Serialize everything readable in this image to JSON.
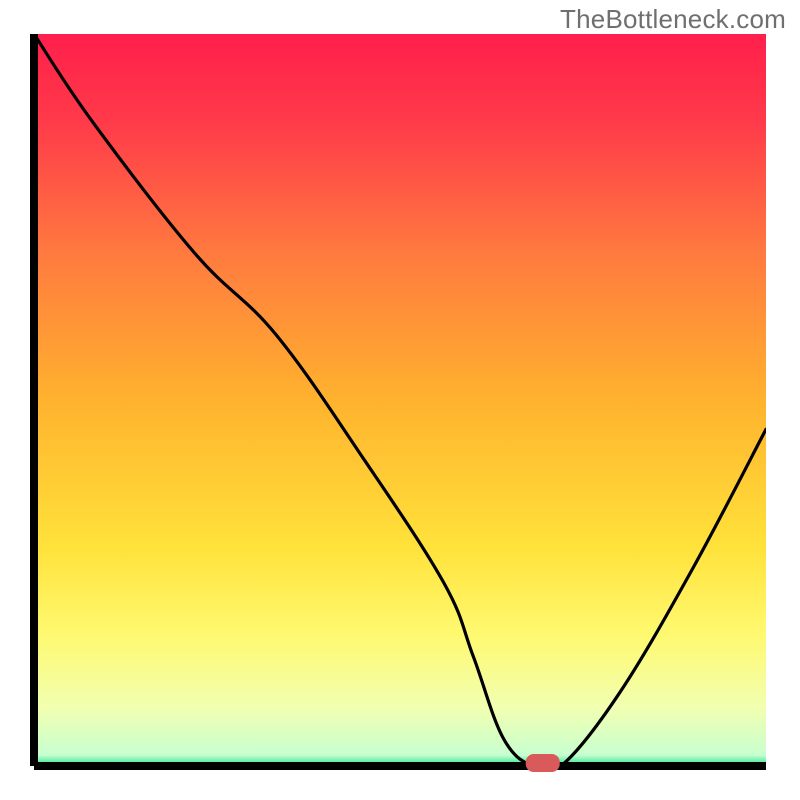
{
  "watermark": {
    "text": "TheBottleneck.com"
  },
  "chart_data": {
    "type": "line",
    "title": "",
    "xlabel": "",
    "ylabel": "",
    "xlim": [
      0,
      100
    ],
    "ylim": [
      0,
      100
    ],
    "series": [
      {
        "name": "bottleneck-curve",
        "x": [
          0,
          8,
          22,
          33,
          45,
          56,
          60,
          64,
          68,
          72,
          80,
          90,
          100
        ],
        "y": [
          100,
          88,
          70,
          59,
          42,
          25,
          15,
          4,
          0,
          0,
          10,
          27,
          46
        ]
      }
    ],
    "marker": {
      "name": "selected-point",
      "x": 69.5,
      "y": 0,
      "color": "#d85a5a"
    },
    "background": {
      "gradient_stops": [
        {
          "offset": 0.0,
          "color": "#ff1f4b"
        },
        {
          "offset": 0.12,
          "color": "#ff3a4a"
        },
        {
          "offset": 0.3,
          "color": "#ff7a3f"
        },
        {
          "offset": 0.5,
          "color": "#ffb22e"
        },
        {
          "offset": 0.7,
          "color": "#ffe23a"
        },
        {
          "offset": 0.82,
          "color": "#fff970"
        },
        {
          "offset": 0.92,
          "color": "#f1ffb0"
        },
        {
          "offset": 0.985,
          "color": "#c8ffd0"
        },
        {
          "offset": 1.0,
          "color": "#1fe28a"
        }
      ]
    },
    "axes_color": "#000000",
    "curve_color": "#000000"
  }
}
